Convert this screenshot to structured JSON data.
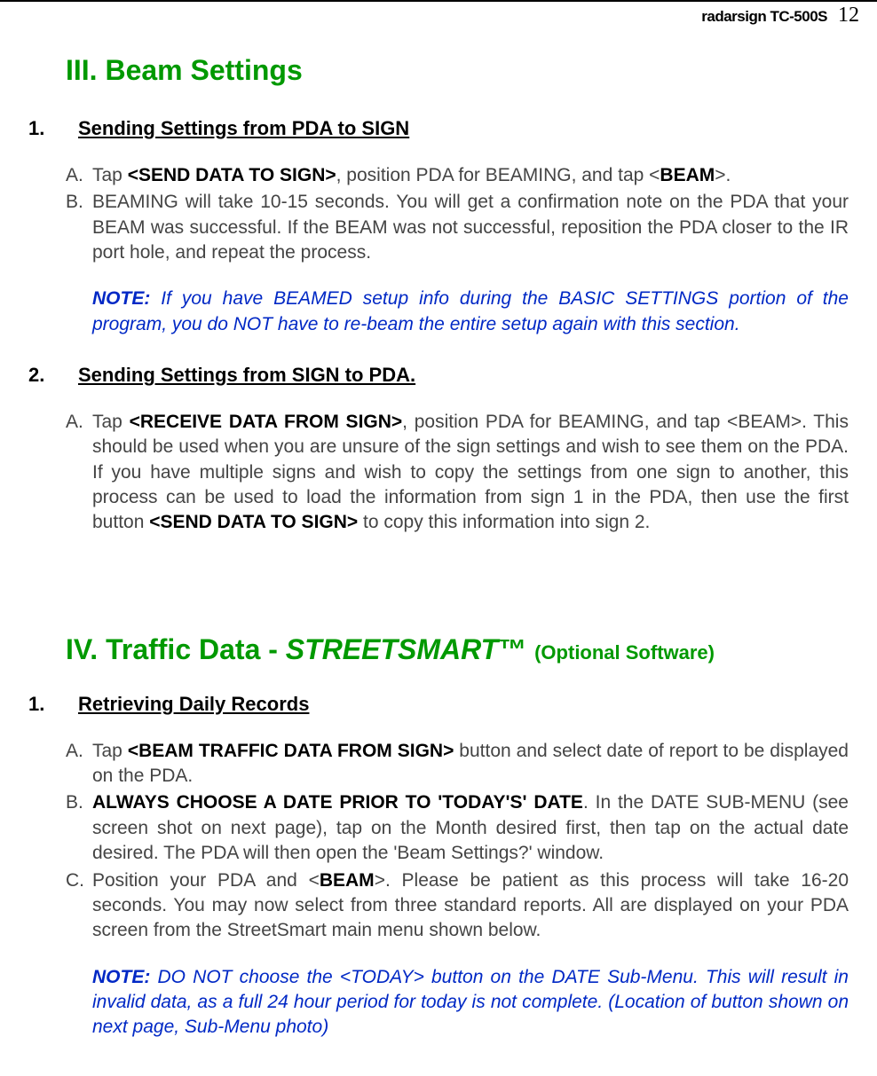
{
  "header": {
    "product": "radarsign TC-500S",
    "page": "12"
  },
  "section3": {
    "heading": "III. Beam Settings",
    "item1": {
      "num": "1.",
      "label": "Sending Settings from PDA to SIGN",
      "a_marker": "A.",
      "a_pre": "Tap ",
      "a_bold": "<SEND DATA TO SIGN>",
      "a_mid": ", position PDA for BEAMING, and tap <",
      "a_bold2": "BEAM",
      "a_post": ">.",
      "b_marker": "B.",
      "b_text": "BEAMING will take 10-15 seconds.  You will get a confirmation note on the PDA that your BEAM was successful.  If the BEAM was not successful, reposition the PDA closer to the IR port hole, and repeat the process.",
      "note_label": "NOTE:",
      "note_text": "  If you have BEAMED setup info during the BASIC SETTINGS portion of the program, you do NOT have to re-beam the entire setup again with this section."
    },
    "item2": {
      "num": "2.",
      "label": "Sending Settings from SIGN to PDA.",
      "a_marker": "A.",
      "a_pre": "Tap ",
      "a_bold": "<RECEIVE DATA FROM SIGN>",
      "a_mid": ", position PDA for BEAMING, and tap <BEAM>.  This should be used when you are unsure of the sign settings and wish to see them on the PDA.  If you have multiple signs and wish to copy the settings from one sign to another, this process can be used to load the information from sign 1 in the PDA, then use the first button ",
      "a_bold2": "<SEND DATA TO SIGN>",
      "a_post": " to copy this information into sign 2."
    }
  },
  "section4": {
    "heading_pre": "IV. Traffic Data - ",
    "heading_italic": "STREETSMART",
    "heading_tm": "™ ",
    "heading_opt": "(Optional Software)",
    "item1": {
      "num": "1.",
      "label": "Retrieving Daily Records",
      "a_marker": "A.",
      "a_pre": "Tap ",
      "a_bold": "<BEAM TRAFFIC DATA FROM SIGN>",
      "a_post": " button and select date of report to be displayed on the PDA.",
      "b_marker": "B.",
      "b_bold": "ALWAYS CHOOSE A DATE PRIOR TO 'TODAY'S' DATE",
      "b_post": ".  In the DATE SUB-MENU (see screen shot on next page), tap on the Month desired first, then tap on the actual date desired.  The PDA will then open the 'Beam Settings?' window.",
      "c_marker": "C.",
      "c_pre": "Position your PDA and <",
      "c_bold": "BEAM",
      "c_post": ">.  Please be patient as this process will take 16-20 seconds.  You may now select from three standard reports.  All are displayed on your PDA screen from the StreetSmart main menu shown below.",
      "note_label": "NOTE:",
      "note_text": " DO NOT choose the <TODAY> button on the DATE Sub-Menu.  This will result in invalid data, as a full 24 hour period for today is not complete.  (Location of button shown on next page, Sub-Menu photo)"
    }
  }
}
